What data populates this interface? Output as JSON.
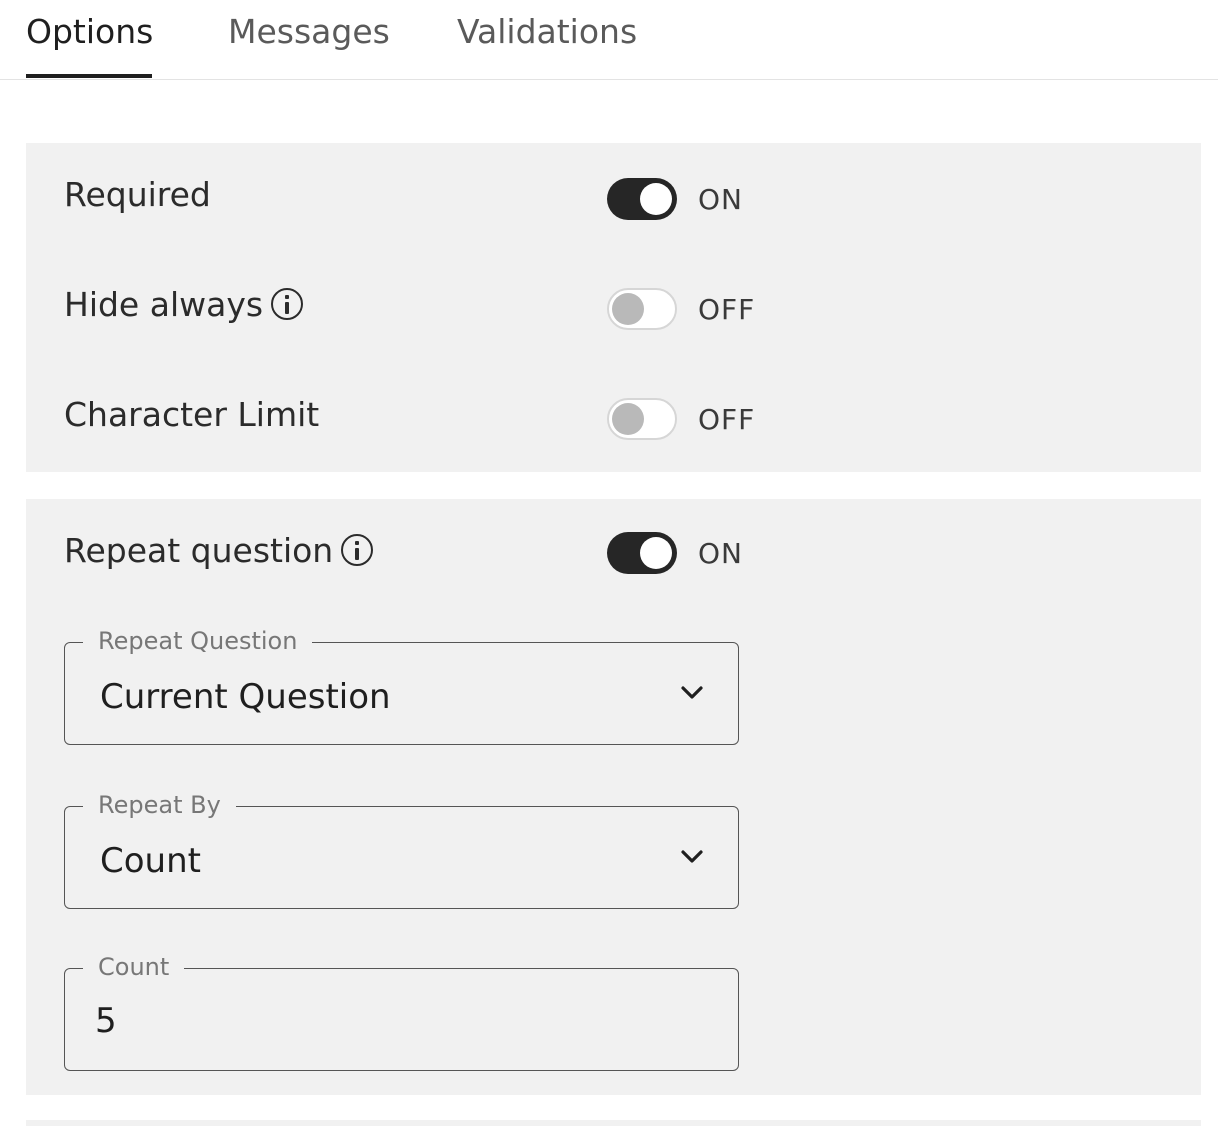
{
  "tabs": [
    {
      "label": "Options",
      "active": true
    },
    {
      "label": "Messages",
      "active": false
    },
    {
      "label": "Validations",
      "active": false
    }
  ],
  "options": {
    "required": {
      "label": "Required",
      "state": "ON"
    },
    "hide_always": {
      "label": "Hide always",
      "state": "OFF"
    },
    "character_limit": {
      "label": "Character Limit",
      "state": "OFF"
    }
  },
  "repeat": {
    "label": "Repeat question",
    "state": "ON",
    "repeat_question": {
      "legend": "Repeat Question",
      "value": "Current Question"
    },
    "repeat_by": {
      "legend": "Repeat By",
      "value": "Count"
    },
    "count": {
      "legend": "Count",
      "value": "5"
    }
  },
  "colors": {
    "toggle_on": "#262626",
    "toggle_off_knob": "#b9b9b9",
    "panel_bg": "#f1f1f1"
  },
  "icons": [
    "info-icon",
    "chevron-down-icon"
  ]
}
